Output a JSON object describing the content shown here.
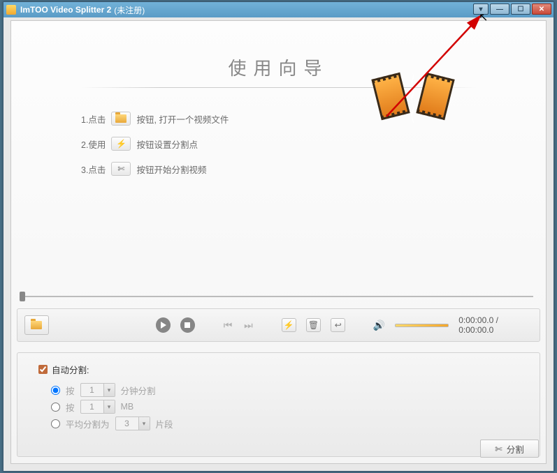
{
  "titlebar": {
    "app_name": "ImTOO Video Splitter 2",
    "suffix": "(未注册)"
  },
  "wizard": {
    "heading": "使用向导",
    "steps": [
      {
        "pre": "1.点击",
        "post": "按钮, 打开一个视频文件"
      },
      {
        "pre": "2.使用",
        "post": "按钮设置分割点"
      },
      {
        "pre": "3.点击",
        "post": "按钮开始分割视频"
      }
    ]
  },
  "player": {
    "time": "0:00:00.0 / 0:00:00.0"
  },
  "autosplit": {
    "checkbox_label": "自动分割:",
    "opt_minutes": {
      "pre": "按",
      "value": "1",
      "post": "分钟分割"
    },
    "opt_mb": {
      "pre": "按",
      "value": "1",
      "post": "MB"
    },
    "opt_avg": {
      "pre": "平均分割为",
      "value": "3",
      "post": "片段"
    }
  },
  "action": {
    "split_label": "分割"
  }
}
